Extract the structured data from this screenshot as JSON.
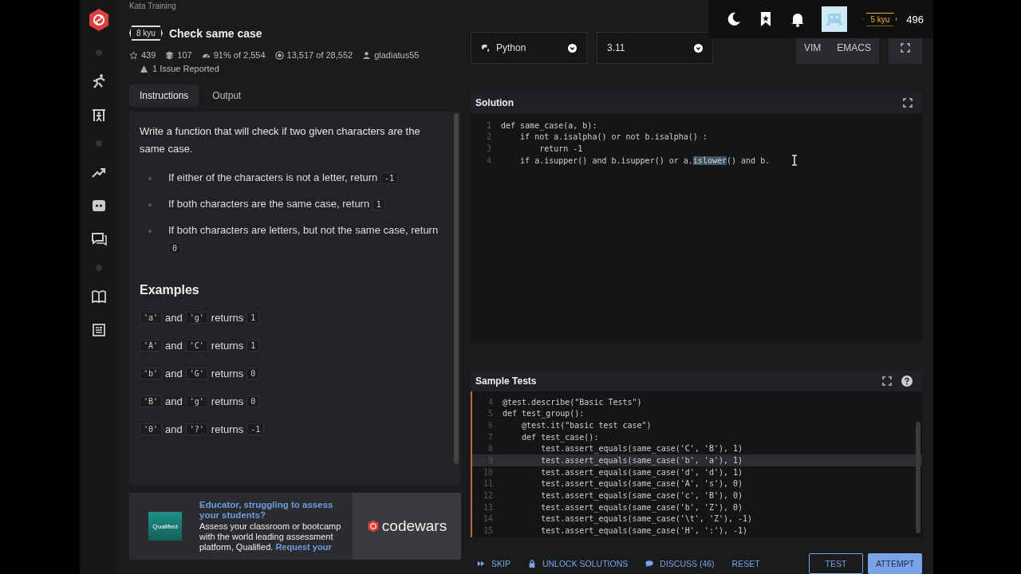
{
  "kata": {
    "breadcrumb": "Kata Training",
    "rank": "8 kyu",
    "title": "Check same case",
    "stats": [
      {
        "kind": "stars",
        "text": "439"
      },
      {
        "kind": "collections",
        "text": "107"
      },
      {
        "kind": "satisfaction",
        "text": "91% of 2,554"
      },
      {
        "kind": "completed",
        "text": "13,517 of 28,552"
      },
      {
        "kind": "author",
        "text": "gladiatus55"
      }
    ],
    "issues": "1 Issue Reported"
  },
  "tabs": [
    {
      "label": "Instructions",
      "selected": true
    },
    {
      "label": "Output",
      "selected": false
    }
  ],
  "description": {
    "intro": "Write a function that will check if two given characters are the same case.",
    "bullets": [
      {
        "text": "If either of the characters is not a letter, return",
        "code": "-1"
      },
      {
        "text": "If both characters are the same case, return",
        "code": "1"
      },
      {
        "text": "If both characters are letters, but not the same case, return",
        "code": "0"
      }
    ],
    "examples_heading": "Examples",
    "examples": [
      {
        "first": "'a'",
        "joiner": "and",
        "second": "'g'",
        "verb": "returns",
        "result": "1"
      },
      {
        "first": "'A'",
        "joiner": "and",
        "second": "'C'",
        "verb": "returns",
        "result": "1"
      },
      {
        "first": "'b'",
        "joiner": "and",
        "second": "'G'",
        "verb": "returns",
        "result": "0"
      },
      {
        "first": "'B'",
        "joiner": "and",
        "second": "'g'",
        "verb": "returns",
        "result": "0"
      },
      {
        "first": "'0'",
        "joiner": "and",
        "second": "'?'",
        "verb": "returns",
        "result": "-1"
      }
    ]
  },
  "ad": {
    "headline": "Educator, struggling to assess your students?",
    "body": "Assess your classroom or bootcamp with the world leading assessment platform, Qualified.",
    "link": "Request your",
    "logo_text": "Qualified",
    "brand": "codewars"
  },
  "header": {
    "rank": "5 kyu",
    "honor": "496"
  },
  "language": {
    "value": "Python"
  },
  "version": {
    "value": "3.11"
  },
  "modes": [
    "VIM",
    "EMACS"
  ],
  "solution": {
    "title": "Solution",
    "lines": [
      {
        "number": "1",
        "parts": [
          {
            "text": "def same_case(a, b):",
            "selected": false
          }
        ]
      },
      {
        "number": "2",
        "parts": [
          {
            "text": "    if not a.isalpha() or not b.isalpha() :",
            "selected": false
          }
        ]
      },
      {
        "number": "3",
        "parts": [
          {
            "text": "        return -1",
            "selected": false
          }
        ]
      },
      {
        "number": "4",
        "parts": [
          {
            "text": "    if a.isupper() and b.isupper() or a.",
            "selected": false
          },
          {
            "text": "islower",
            "selected": true
          },
          {
            "text": "() and b.",
            "selected": false
          }
        ]
      }
    ]
  },
  "sample_tests": {
    "title": "Sample Tests",
    "lines": [
      {
        "number": "4",
        "code": "@test.describe(\"Basic Tests\")",
        "active": false
      },
      {
        "number": "5",
        "code": "def test_group():",
        "active": false
      },
      {
        "number": "6",
        "code": "    @test.it(\"basic test case\")",
        "active": false
      },
      {
        "number": "7",
        "code": "    def test_case():",
        "active": false
      },
      {
        "number": "8",
        "code": "        test.assert_equals(same_case('C', 'B'), 1)",
        "active": false
      },
      {
        "number": "9",
        "code": "        test.assert_equals(same_case('b', 'a'), 1)",
        "active": true
      },
      {
        "number": "10",
        "code": "        test.assert_equals(same_case('d', 'd'), 1)",
        "active": false
      },
      {
        "number": "11",
        "code": "        test.assert_equals(same_case('A', 's'), 0)",
        "active": false
      },
      {
        "number": "12",
        "code": "        test.assert_equals(same_case('c', 'B'), 0)",
        "active": false
      },
      {
        "number": "13",
        "code": "        test.assert_equals(same_case('b', 'Z'), 0)",
        "active": false
      },
      {
        "number": "14",
        "code": "        test.assert_equals(same_case('\\t', 'Z'), -1)",
        "active": false
      },
      {
        "number": "15",
        "code": "        test.assert_equals(same_case('H', ':'), -1)",
        "active": false
      }
    ]
  },
  "actions": [
    {
      "kind": "skip",
      "label": "SKIP"
    },
    {
      "kind": "unlock",
      "label": "UNLOCK SOLUTIONS"
    },
    {
      "kind": "discuss",
      "label": "DISCUSS (46)"
    },
    {
      "kind": "reset",
      "label": "RESET"
    }
  ],
  "buttons": [
    {
      "kind": "outline",
      "label": "TEST"
    },
    {
      "kind": "primary",
      "label": "ATTEMPT"
    }
  ]
}
